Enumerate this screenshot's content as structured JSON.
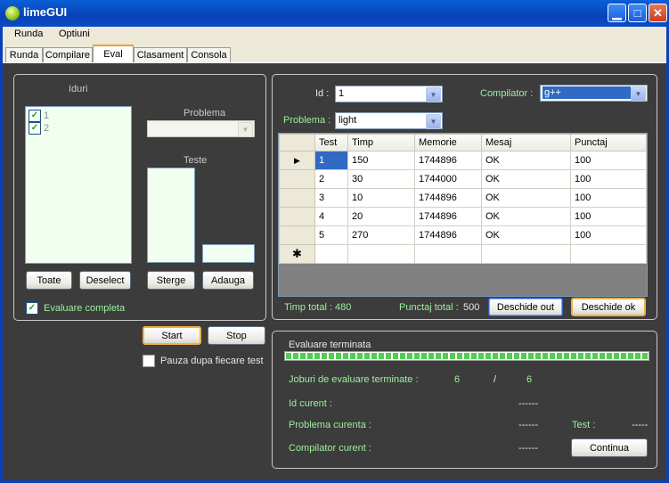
{
  "window": {
    "title": "limeGUI"
  },
  "menu": [
    "Runda",
    "Optiuni"
  ],
  "tabs": [
    {
      "label": "Runda",
      "active": false
    },
    {
      "label": "Compilare",
      "active": false
    },
    {
      "label": "Eval",
      "active": true
    },
    {
      "label": "Clasament",
      "active": false
    },
    {
      "label": "Consola",
      "active": false
    }
  ],
  "left": {
    "iduri_label": "Iduri",
    "iduri": [
      {
        "label": "1",
        "checked": true
      },
      {
        "label": "2",
        "checked": true
      }
    ],
    "problema_label": "Problema",
    "problema_value": "",
    "teste_label": "Teste",
    "teste_input": "",
    "toate": "Toate",
    "deselect": "Deselect",
    "sterge": "Sterge",
    "adauga": "Adauga",
    "evaluare_completa": "Evaluare completa",
    "evaluare_completa_checked": true,
    "start": "Start",
    "stop": "Stop",
    "pauza": "Pauza dupa fiecare test",
    "pauza_checked": false
  },
  "right": {
    "id_label": "Id :",
    "id_value": "1",
    "compilator_label": "Compilator :",
    "compilator_value": "g++",
    "problema_label": "Problema :",
    "problema_value": "light",
    "columns": [
      "Test",
      "Timp",
      "Memorie",
      "Mesaj",
      "Punctaj"
    ],
    "rows": [
      [
        "1",
        "150",
        "1744896",
        "OK",
        "100"
      ],
      [
        "2",
        "30",
        "1744000",
        "OK",
        "100"
      ],
      [
        "3",
        "10",
        "1744896",
        "OK",
        "100"
      ],
      [
        "4",
        "20",
        "1744896",
        "OK",
        "100"
      ],
      [
        "5",
        "270",
        "1744896",
        "OK",
        "100"
      ]
    ],
    "timp_total_label": "Timp total :",
    "timp_total": "480",
    "punctaj_total_label": "Punctaj total :",
    "punctaj_total": "500",
    "deschide_out": "Deschide out",
    "deschide_ok": "Deschide ok"
  },
  "status": {
    "title": "Evaluare terminata",
    "progress": 1.0,
    "joburi_label": "Joburi de evaluare terminate :",
    "joburi_done": "6",
    "joburi_sep": "/",
    "joburi_total": "6",
    "id_curent_label": "Id curent :",
    "id_curent": "------",
    "problema_curenta_label": "Problema curenta :",
    "problema_curenta": "------",
    "test_label": "Test :",
    "test_value": "-----",
    "compilator_curent_label": "Compilator curent :",
    "compilator_curent": "------",
    "continua": "Continua"
  },
  "colors": {
    "title_bar": "#0842b8",
    "background": "#3c3c3c",
    "grid_selection": "#316ac5",
    "label_green": "#9ef09e",
    "progress": "#4fcf4f"
  }
}
